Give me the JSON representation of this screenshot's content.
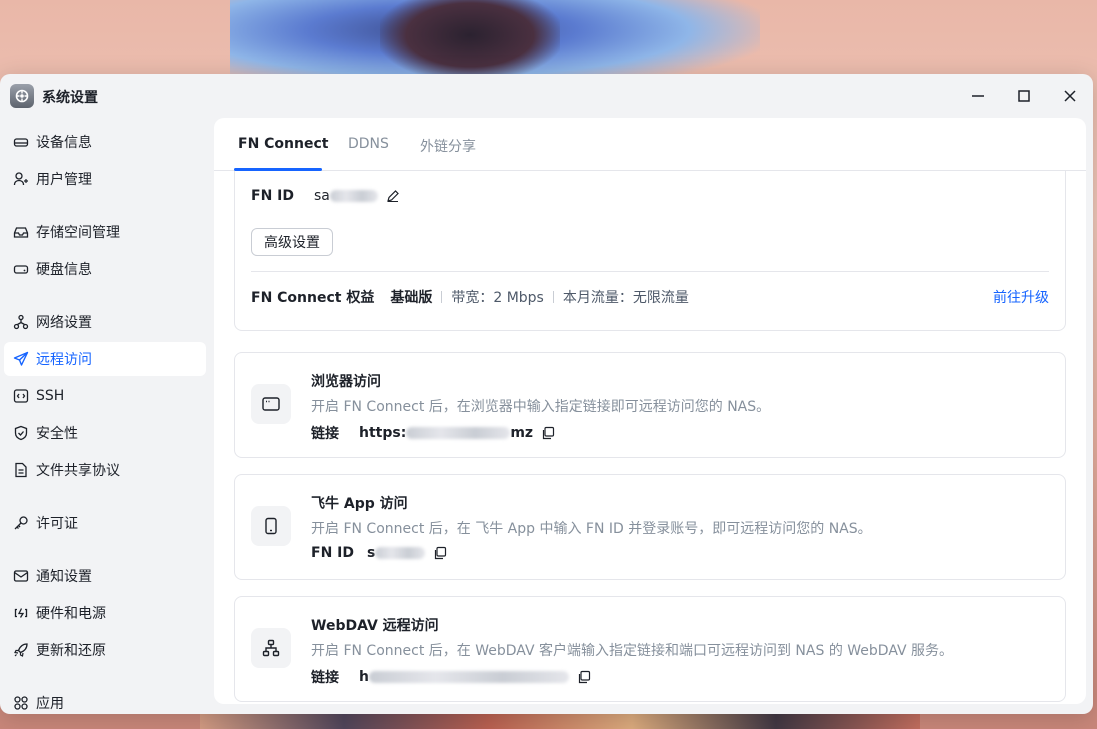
{
  "window": {
    "title": "系统设置"
  },
  "sidebar": {
    "items": [
      {
        "label": "设备信息",
        "icon": "device-icon"
      },
      {
        "label": "用户管理",
        "icon": "user-icon"
      },
      {
        "label": "存储空间管理",
        "icon": "storage-icon"
      },
      {
        "label": "硬盘信息",
        "icon": "disk-icon"
      },
      {
        "label": "网络设置",
        "icon": "network-icon"
      },
      {
        "label": "远程访问",
        "icon": "send-icon",
        "active": true
      },
      {
        "label": "SSH",
        "icon": "ssh-icon"
      },
      {
        "label": "安全性",
        "icon": "shield-icon"
      },
      {
        "label": "文件共享协议",
        "icon": "file-icon"
      },
      {
        "label": "许可证",
        "icon": "key-icon"
      },
      {
        "label": "通知设置",
        "icon": "mail-icon"
      },
      {
        "label": "硬件和电源",
        "icon": "power-icon"
      },
      {
        "label": "更新和还原",
        "icon": "rocket-icon"
      },
      {
        "label": "应用",
        "icon": "apps-icon"
      }
    ]
  },
  "tabs": [
    "FN Connect",
    "DDNS",
    "外链分享"
  ],
  "fn_connect": {
    "fn_id_label": "FN ID",
    "fn_id_value": "sa",
    "advanced_button": "高级设置",
    "rights_label": "FN Connect 权益",
    "plan": "基础版",
    "bandwidth": "带宽：2 Mbps",
    "traffic": "本月流量：无限流量",
    "upgrade_link": "前往升级"
  },
  "services": [
    {
      "title": "浏览器访问",
      "desc": "开启 FN Connect 后，在浏览器中输入指定链接即可远程访问您的 NAS。",
      "row_label": "链接",
      "row_value_start": "https:",
      "row_value_end": "mz"
    },
    {
      "title": "飞牛 App 访问",
      "desc": "开启 FN Connect 后，在 飞牛 App 中输入 FN ID 并登录账号，即可远程访问您的 NAS。",
      "row_label": "FN ID",
      "row_value_start": "s",
      "row_value_end": ""
    },
    {
      "title": "WebDAV 远程访问",
      "desc": "开启 FN Connect 后，在 WebDAV 客户端输入指定链接和端口可远程访问到 NAS 的 WebDAV 服务。",
      "row_label": "链接",
      "row_value_start": "h",
      "row_value_end": ""
    }
  ],
  "colors": {
    "accent": "#1664ff",
    "text": "#1d2129",
    "muted": "#86909c"
  }
}
